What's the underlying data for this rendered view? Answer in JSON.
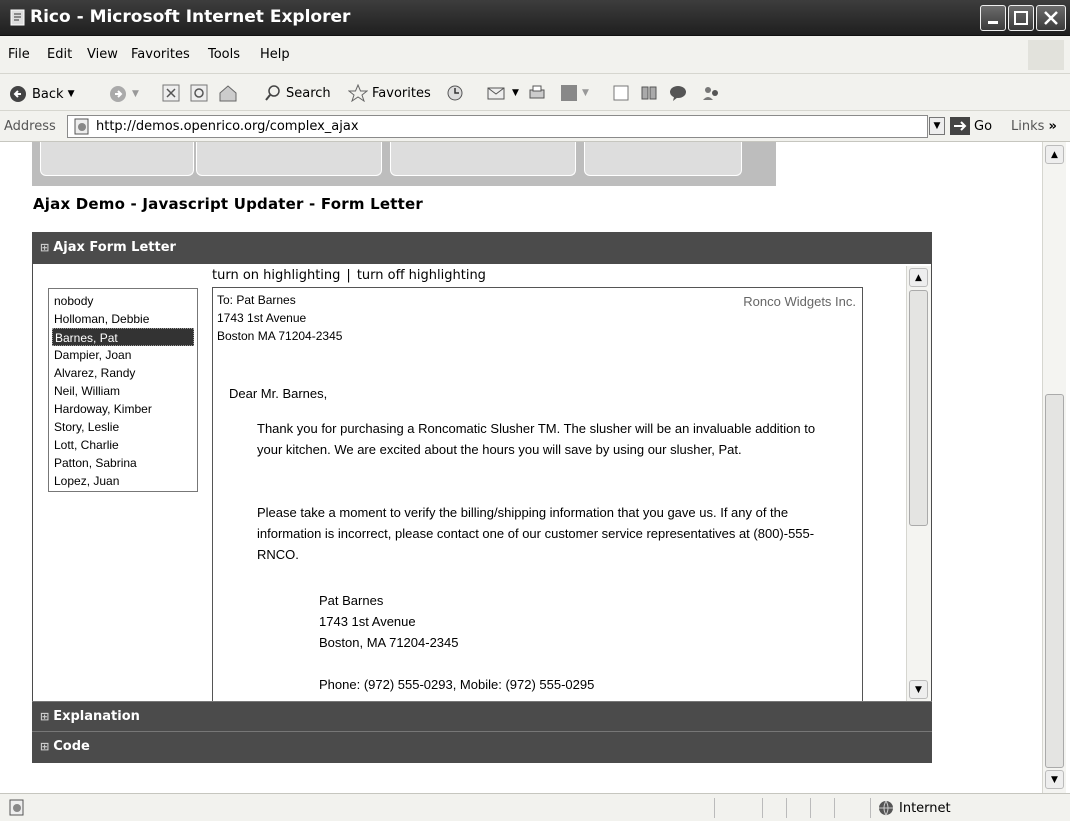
{
  "window": {
    "title": "Rico - Microsoft Internet Explorer"
  },
  "menu": {
    "items": [
      "File",
      "Edit",
      "View",
      "Favorites",
      "Tools",
      "Help"
    ]
  },
  "toolbar": {
    "back_label": "Back",
    "search_label": "Search",
    "favorites_label": "Favorites"
  },
  "address": {
    "label": "Address",
    "url": "http://demos.openrico.org/complex_ajax",
    "go_label": "Go",
    "links_label": "Links"
  },
  "page": {
    "heading": "Ajax Demo - Javascript Updater - Form Letter",
    "panels": {
      "form_letter": "Ajax Form Letter",
      "explanation": "Explanation",
      "code": "Code"
    },
    "highlight": {
      "on": "turn on highlighting",
      "sep": "|",
      "off": "turn off highlighting"
    },
    "names": [
      {
        "label": "nobody",
        "selected": false
      },
      {
        "label": "Holloman, Debbie",
        "selected": false
      },
      {
        "label": "Barnes, Pat",
        "selected": true
      },
      {
        "label": "Dampier, Joan",
        "selected": false
      },
      {
        "label": "Alvarez, Randy",
        "selected": false
      },
      {
        "label": "Neil, William",
        "selected": false
      },
      {
        "label": "Hardoway, Kimber",
        "selected": false
      },
      {
        "label": "Story, Leslie",
        "selected": false
      },
      {
        "label": "Lott, Charlie",
        "selected": false
      },
      {
        "label": "Patton, Sabrina",
        "selected": false
      },
      {
        "label": "Lopez, Juan",
        "selected": false
      }
    ],
    "letter": {
      "company": "Ronco Widgets Inc.",
      "to_lines": [
        "To: Pat Barnes",
        "1743 1st Avenue",
        "Boston MA 71204-2345"
      ],
      "greeting": "Dear Mr. Barnes,",
      "para1": "Thank you for purchasing a Roncomatic Slusher TM. The slusher will be an invaluable addition to your kitchen. We are excited about the hours you will save by using our slusher, Pat.",
      "para2": "Please take a moment to verify the billing/shipping information that you gave us. If any of the information is incorrect, please contact one of our customer service representatives at (800)-555-RNCO.",
      "ship_lines": [
        "Pat Barnes",
        "1743 1st Avenue",
        "Boston, MA 71204-2345"
      ],
      "phone": "Phone: (972) 555-0293, Mobile: (972) 555-0295"
    }
  },
  "status": {
    "zone": "Internet"
  },
  "colors": {
    "panel_header": "#4b4b4b",
    "selected_row": "#333333",
    "chrome": "#f2f2ee"
  }
}
